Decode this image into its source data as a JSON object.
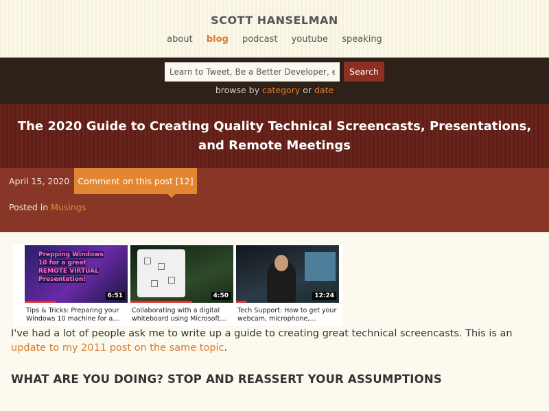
{
  "site": {
    "title": "SCOTT HANSELMAN",
    "nav": [
      {
        "label": "about",
        "active": false
      },
      {
        "label": "blog",
        "active": true
      },
      {
        "label": "podcast",
        "active": false
      },
      {
        "label": "youtube",
        "active": false
      },
      {
        "label": "speaking",
        "active": false
      }
    ]
  },
  "search": {
    "value": "Learn to Tweet, Be a Better Developer, e",
    "button_label": "Search",
    "browse_prefix": "browse by",
    "browse_category": "category",
    "browse_or": "or",
    "browse_date": "date"
  },
  "post": {
    "title": "The 2020 Guide to Creating Quality Technical Screencasts, Presentations, and Remote Meetings",
    "date": "April 15, 2020",
    "comment_link": "Comment on this post [12]",
    "posted_in_label": "Posted in",
    "category": "Musings"
  },
  "videos": [
    {
      "overlay": "Prepping Windows 10 for a great REMOTE VIRTUAL Presentation!",
      "duration": "6:51",
      "caption": "Tips & Tricks: Preparing your Windows 10 machine for a…",
      "progress": 0.3
    },
    {
      "overlay": "",
      "duration": "4:50",
      "caption": "Collaborating with a digital whiteboard using Microsoft…",
      "progress": 0.6
    },
    {
      "overlay": "",
      "duration": "12:24",
      "caption": "Tech Support: How to get your webcam, microphone,…",
      "progress": 0.1
    }
  ],
  "content": {
    "intro_text": "I've had a lot of people ask me to write up a guide to creating great technical screencasts. This is an ",
    "intro_link": "update to my 2011 post on the same topic",
    "intro_end": ".",
    "heading": "WHAT ARE YOU DOING? STOP AND REASSERT YOUR ASSUMPTIONS"
  }
}
